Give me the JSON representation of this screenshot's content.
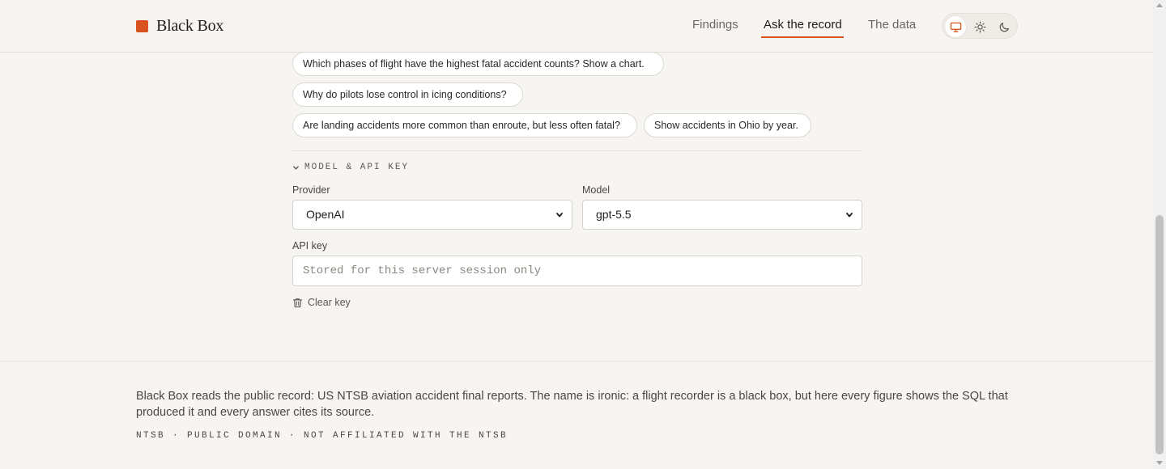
{
  "header": {
    "brand": "Black Box",
    "nav": {
      "findings": "Findings",
      "ask": "Ask the record",
      "data": "The data"
    },
    "theme": {
      "options": [
        "monitor-icon",
        "sun-icon",
        "moon-icon"
      ],
      "selected": "system"
    },
    "accent": "#d9531e"
  },
  "suggestions": [
    "Which phases of flight have the highest fatal accident counts? Show a chart.",
    "Why do pilots lose control in icing conditions?",
    "Are landing accidents more common than enroute, but less often fatal?",
    "Show accidents in Ohio by year."
  ],
  "settings": {
    "section_title": "MODEL & API KEY",
    "provider_label": "Provider",
    "provider_value": "OpenAI",
    "model_label": "Model",
    "model_value": "gpt-5.5",
    "api_key_label": "API key",
    "api_key_placeholder": "Stored for this server session only",
    "clear_key": "Clear key"
  },
  "footer": {
    "text": "Black Box reads the public record: US NTSB aviation accident final reports. The name is ironic: a flight recorder is a black box, but here every figure shows the SQL that produced it and every answer cites its source.",
    "meta": "NTSB · PUBLIC DOMAIN · NOT AFFILIATED WITH THE NTSB"
  }
}
